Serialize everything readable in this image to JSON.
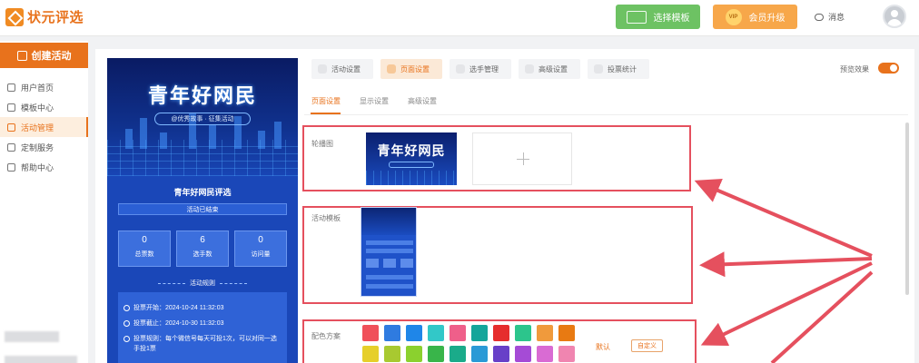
{
  "header": {
    "logo_text": "状元评选",
    "select_template": "选择模板",
    "vip_badge": "VIP",
    "upgrade": "会员升级",
    "messages": "消息"
  },
  "sidebar": {
    "create": "创建活动",
    "items": [
      {
        "label": "用户首页",
        "icon": "home-icon"
      },
      {
        "label": "模板中心",
        "icon": "template-icon"
      },
      {
        "label": "活动管理",
        "icon": "activity-icon",
        "active": true
      },
      {
        "label": "定制服务",
        "icon": "custom-service-icon"
      },
      {
        "label": "帮助中心",
        "icon": "help-icon"
      }
    ]
  },
  "preview": {
    "banner_title": "青年好网民",
    "banner_subtitle": "@优秀故事 · 征集活动",
    "title": "青年好网民评选",
    "status": "活动已结束",
    "stats": [
      {
        "value": "0",
        "label": "总票数"
      },
      {
        "value": "6",
        "label": "选手数"
      },
      {
        "value": "0",
        "label": "访问量"
      }
    ],
    "rules_title": "活动规则",
    "rules": [
      "投票开始：2024-10-24 11:32:03",
      "投票截止：2024-10-30 11:32:03",
      "投票规则：每个微信号每天可投1次，可以对同一选手投1票"
    ]
  },
  "tabs": [
    {
      "label": "活动设置",
      "icon": "settings-icon"
    },
    {
      "label": "页面设置",
      "icon": "page-icon",
      "active": true
    },
    {
      "label": "选手管理",
      "icon": "user-icon"
    },
    {
      "label": "高级设置",
      "icon": "advanced-icon"
    },
    {
      "label": "投票统计",
      "icon": "stats-icon"
    }
  ],
  "preview_toggle": {
    "label": "预览效果",
    "on": true
  },
  "subtabs": [
    {
      "label": "页面设置",
      "active": true
    },
    {
      "label": "显示设置"
    },
    {
      "label": "高级设置"
    }
  ],
  "sections": {
    "carousel": {
      "label": "轮播图",
      "thumb_title": "青年好网民"
    },
    "template": {
      "label": "活动模板"
    },
    "color": {
      "label": "配色方案",
      "default": "默认",
      "custom": "自定义",
      "swatches": [
        "#f0505a",
        "#2f7be0",
        "#1f86e8",
        "#32c8c8",
        "#ef5f8a",
        "#15a59a",
        "#e62d2d",
        "#2cc58c",
        "#f09a3c",
        "#e87a12",
        "#e6cf2a",
        "#a8c930",
        "#8bd12e",
        "#39b54a",
        "#1aab8a",
        "#2a9ad6",
        "#6840c8",
        "#a54bd6",
        "#d96bd3",
        "#f085b0"
      ]
    }
  },
  "colors": {
    "accent": "#e8721c",
    "template_green": "#6dc263",
    "vip_orange": "#f7a74a",
    "highlight_red": "#e5505e"
  }
}
